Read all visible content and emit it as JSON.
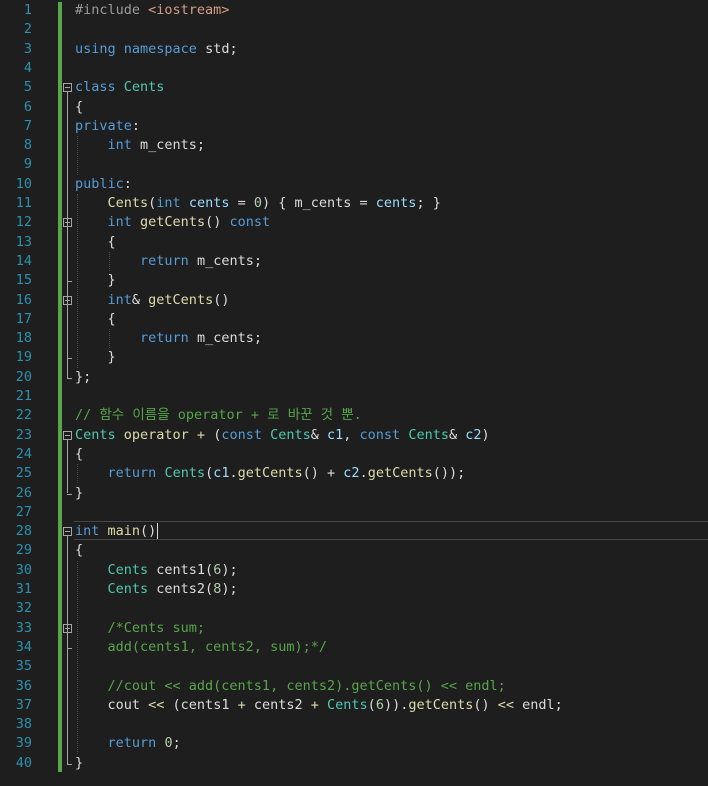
{
  "editor": {
    "language": "C++",
    "caret_line": 28,
    "colors": {
      "background": "#1e1e1e",
      "line_number": "#2b91af",
      "keyword": "#569cd6",
      "type": "#4ec9b0",
      "function": "#dcdcaa",
      "parameter": "#9cdcfe",
      "number": "#b5cea8",
      "comment": "#57a64a",
      "change_bar": "#57a64a"
    },
    "lines": [
      {
        "n": "1",
        "tokens": [
          {
            "t": "#include ",
            "c": "pp"
          },
          {
            "t": "<iostream>",
            "c": "st"
          }
        ]
      },
      {
        "n": "2",
        "tokens": []
      },
      {
        "n": "3",
        "tokens": [
          {
            "t": "using",
            "c": "kw"
          },
          {
            "t": " "
          },
          {
            "t": "namespace",
            "c": "kw"
          },
          {
            "t": " std;"
          }
        ]
      },
      {
        "n": "4",
        "tokens": []
      },
      {
        "n": "5",
        "tokens": [
          {
            "t": "class",
            "c": "kw"
          },
          {
            "t": " "
          },
          {
            "t": "Cents",
            "c": "ty"
          }
        ]
      },
      {
        "n": "6",
        "tokens": [
          {
            "t": "{"
          }
        ]
      },
      {
        "n": "7",
        "tokens": [
          {
            "t": "private",
            "c": "kw"
          },
          {
            "t": ":"
          }
        ]
      },
      {
        "n": "8",
        "tokens": [
          {
            "t": "    "
          },
          {
            "t": "int",
            "c": "kw"
          },
          {
            "t": " m_cents;"
          }
        ]
      },
      {
        "n": "9",
        "tokens": []
      },
      {
        "n": "10",
        "tokens": [
          {
            "t": "public",
            "c": "kw"
          },
          {
            "t": ":"
          }
        ]
      },
      {
        "n": "11",
        "tokens": [
          {
            "t": "    "
          },
          {
            "t": "Cents",
            "c": "fn"
          },
          {
            "t": "("
          },
          {
            "t": "int",
            "c": "kw"
          },
          {
            "t": " "
          },
          {
            "t": "cents",
            "c": "pa"
          },
          {
            "t": " = "
          },
          {
            "t": "0",
            "c": "nu"
          },
          {
            "t": ") { m_cents = "
          },
          {
            "t": "cents",
            "c": "pa"
          },
          {
            "t": "; }"
          }
        ]
      },
      {
        "n": "12",
        "tokens": [
          {
            "t": "    "
          },
          {
            "t": "int",
            "c": "kw"
          },
          {
            "t": " "
          },
          {
            "t": "getCents",
            "c": "fn"
          },
          {
            "t": "() "
          },
          {
            "t": "const",
            "c": "kw"
          }
        ]
      },
      {
        "n": "13",
        "tokens": [
          {
            "t": "    {"
          }
        ]
      },
      {
        "n": "14",
        "tokens": [
          {
            "t": "        "
          },
          {
            "t": "return",
            "c": "kw"
          },
          {
            "t": " m_cents;"
          }
        ]
      },
      {
        "n": "15",
        "tokens": [
          {
            "t": "    }"
          }
        ]
      },
      {
        "n": "16",
        "tokens": [
          {
            "t": "    "
          },
          {
            "t": "int",
            "c": "kw"
          },
          {
            "t": "& "
          },
          {
            "t": "getCents",
            "c": "fn"
          },
          {
            "t": "()"
          }
        ]
      },
      {
        "n": "17",
        "tokens": [
          {
            "t": "    {"
          }
        ]
      },
      {
        "n": "18",
        "tokens": [
          {
            "t": "        "
          },
          {
            "t": "return",
            "c": "kw"
          },
          {
            "t": " m_cents;"
          }
        ]
      },
      {
        "n": "19",
        "tokens": [
          {
            "t": "    }"
          }
        ]
      },
      {
        "n": "20",
        "tokens": [
          {
            "t": "};"
          }
        ]
      },
      {
        "n": "21",
        "tokens": []
      },
      {
        "n": "22",
        "tokens": [
          {
            "t": "// 함수 이름을 operator + 로 바꾼 것 뿐.",
            "c": "cm"
          }
        ]
      },
      {
        "n": "23",
        "tokens": [
          {
            "t": "Cents",
            "c": "ty"
          },
          {
            "t": " "
          },
          {
            "t": "operator +",
            "c": "fn"
          },
          {
            "t": " ("
          },
          {
            "t": "const",
            "c": "kw"
          },
          {
            "t": " "
          },
          {
            "t": "Cents",
            "c": "ty"
          },
          {
            "t": "& "
          },
          {
            "t": "c1",
            "c": "pa"
          },
          {
            "t": ", "
          },
          {
            "t": "const",
            "c": "kw"
          },
          {
            "t": " "
          },
          {
            "t": "Cents",
            "c": "ty"
          },
          {
            "t": "& "
          },
          {
            "t": "c2",
            "c": "pa"
          },
          {
            "t": ")"
          }
        ]
      },
      {
        "n": "24",
        "tokens": [
          {
            "t": "{"
          }
        ]
      },
      {
        "n": "25",
        "tokens": [
          {
            "t": "    "
          },
          {
            "t": "return",
            "c": "kw"
          },
          {
            "t": " "
          },
          {
            "t": "Cents",
            "c": "ty"
          },
          {
            "t": "("
          },
          {
            "t": "c1",
            "c": "pa"
          },
          {
            "t": "."
          },
          {
            "t": "getCents",
            "c": "fn"
          },
          {
            "t": "() + "
          },
          {
            "t": "c2",
            "c": "pa"
          },
          {
            "t": "."
          },
          {
            "t": "getCents",
            "c": "fn"
          },
          {
            "t": "());"
          }
        ]
      },
      {
        "n": "26",
        "tokens": [
          {
            "t": "}"
          }
        ]
      },
      {
        "n": "27",
        "tokens": []
      },
      {
        "n": "28",
        "tokens": [
          {
            "t": "int",
            "c": "kw"
          },
          {
            "t": " "
          },
          {
            "t": "main",
            "c": "fn"
          },
          {
            "t": "()"
          }
        ]
      },
      {
        "n": "29",
        "tokens": [
          {
            "t": "{"
          }
        ]
      },
      {
        "n": "30",
        "tokens": [
          {
            "t": "    "
          },
          {
            "t": "Cents",
            "c": "ty"
          },
          {
            "t": " cents1("
          },
          {
            "t": "6",
            "c": "nu"
          },
          {
            "t": ");"
          }
        ]
      },
      {
        "n": "31",
        "tokens": [
          {
            "t": "    "
          },
          {
            "t": "Cents",
            "c": "ty"
          },
          {
            "t": " cents2("
          },
          {
            "t": "8",
            "c": "nu"
          },
          {
            "t": ");"
          }
        ]
      },
      {
        "n": "32",
        "tokens": []
      },
      {
        "n": "33",
        "tokens": [
          {
            "t": "    /*Cents sum;",
            "c": "cm"
          }
        ]
      },
      {
        "n": "34",
        "tokens": [
          {
            "t": "    add(cents1, cents2, sum);*/",
            "c": "cm"
          }
        ]
      },
      {
        "n": "35",
        "tokens": []
      },
      {
        "n": "36",
        "tokens": [
          {
            "t": "    //cout << add(cents1, cents2).getCents() << endl;",
            "c": "cm"
          }
        ]
      },
      {
        "n": "37",
        "tokens": [
          {
            "t": "    cout "
          },
          {
            "t": "<<",
            "c": "fn"
          },
          {
            "t": " (cents1 "
          },
          {
            "t": "+",
            "c": "fn"
          },
          {
            "t": " cents2 "
          },
          {
            "t": "+",
            "c": "fn"
          },
          {
            "t": " "
          },
          {
            "t": "Cents",
            "c": "ty"
          },
          {
            "t": "("
          },
          {
            "t": "6",
            "c": "nu"
          },
          {
            "t": "))."
          },
          {
            "t": "getCents",
            "c": "fn"
          },
          {
            "t": "() "
          },
          {
            "t": "<<",
            "c": "fn"
          },
          {
            "t": " endl;"
          }
        ]
      },
      {
        "n": "38",
        "tokens": []
      },
      {
        "n": "39",
        "tokens": [
          {
            "t": "    "
          },
          {
            "t": "return",
            "c": "kw"
          },
          {
            "t": " "
          },
          {
            "t": "0",
            "c": "nu"
          },
          {
            "t": ";"
          }
        ]
      },
      {
        "n": "40",
        "tokens": [
          {
            "t": "}"
          }
        ]
      }
    ]
  }
}
